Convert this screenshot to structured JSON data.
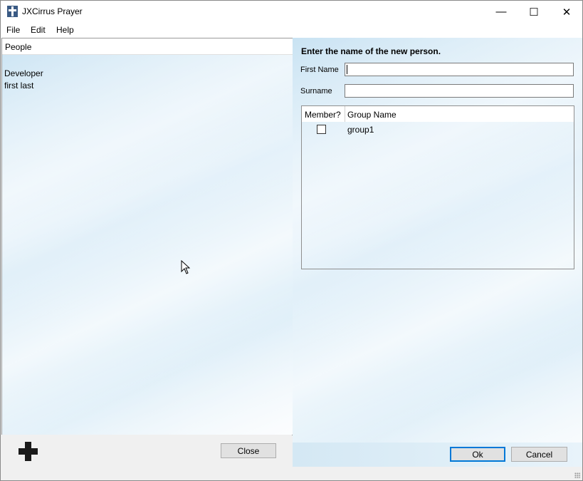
{
  "window": {
    "title": "JXCirrus Prayer",
    "controls": {
      "minimize": "—",
      "maximize": "☐",
      "close": "✕"
    }
  },
  "menu": {
    "items": [
      "File",
      "Edit",
      "Help"
    ]
  },
  "people_panel": {
    "header": "People",
    "items": [
      "Developer",
      "first last"
    ]
  },
  "form": {
    "prompt": "Enter the name of the new person.",
    "first_name_label": "First Name",
    "first_name_value": "",
    "surname_label": "Surname",
    "surname_value": ""
  },
  "groups_table": {
    "columns": [
      "Member?",
      "Group Name"
    ],
    "rows": [
      {
        "member": false,
        "name": "group1"
      }
    ]
  },
  "buttons": {
    "close": "Close",
    "ok": "Ok",
    "cancel": "Cancel"
  },
  "icons": {
    "add": "plus-icon",
    "app": "cross-icon"
  }
}
